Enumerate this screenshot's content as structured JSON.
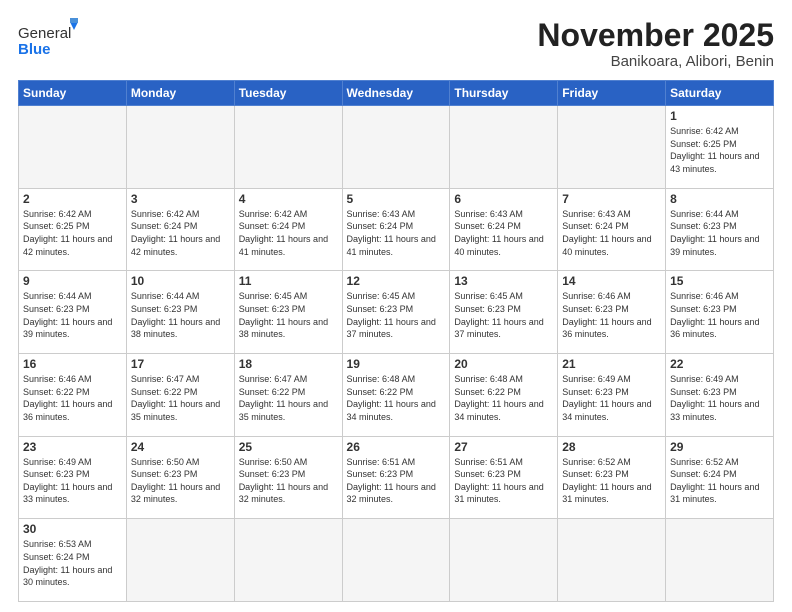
{
  "header": {
    "logo_general": "General",
    "logo_blue": "Blue",
    "month_title": "November 2025",
    "subtitle": "Banikoara, Alibori, Benin"
  },
  "weekdays": [
    "Sunday",
    "Monday",
    "Tuesday",
    "Wednesday",
    "Thursday",
    "Friday",
    "Saturday"
  ],
  "weeks": [
    [
      {
        "day": "",
        "info": ""
      },
      {
        "day": "",
        "info": ""
      },
      {
        "day": "",
        "info": ""
      },
      {
        "day": "",
        "info": ""
      },
      {
        "day": "",
        "info": ""
      },
      {
        "day": "",
        "info": ""
      },
      {
        "day": "1",
        "info": "Sunrise: 6:42 AM\nSunset: 6:25 PM\nDaylight: 11 hours\nand 43 minutes."
      }
    ],
    [
      {
        "day": "2",
        "info": "Sunrise: 6:42 AM\nSunset: 6:25 PM\nDaylight: 11 hours\nand 42 minutes."
      },
      {
        "day": "3",
        "info": "Sunrise: 6:42 AM\nSunset: 6:24 PM\nDaylight: 11 hours\nand 42 minutes."
      },
      {
        "day": "4",
        "info": "Sunrise: 6:42 AM\nSunset: 6:24 PM\nDaylight: 11 hours\nand 41 minutes."
      },
      {
        "day": "5",
        "info": "Sunrise: 6:43 AM\nSunset: 6:24 PM\nDaylight: 11 hours\nand 41 minutes."
      },
      {
        "day": "6",
        "info": "Sunrise: 6:43 AM\nSunset: 6:24 PM\nDaylight: 11 hours\nand 40 minutes."
      },
      {
        "day": "7",
        "info": "Sunrise: 6:43 AM\nSunset: 6:24 PM\nDaylight: 11 hours\nand 40 minutes."
      },
      {
        "day": "8",
        "info": "Sunrise: 6:44 AM\nSunset: 6:23 PM\nDaylight: 11 hours\nand 39 minutes."
      }
    ],
    [
      {
        "day": "9",
        "info": "Sunrise: 6:44 AM\nSunset: 6:23 PM\nDaylight: 11 hours\nand 39 minutes."
      },
      {
        "day": "10",
        "info": "Sunrise: 6:44 AM\nSunset: 6:23 PM\nDaylight: 11 hours\nand 38 minutes."
      },
      {
        "day": "11",
        "info": "Sunrise: 6:45 AM\nSunset: 6:23 PM\nDaylight: 11 hours\nand 38 minutes."
      },
      {
        "day": "12",
        "info": "Sunrise: 6:45 AM\nSunset: 6:23 PM\nDaylight: 11 hours\nand 37 minutes."
      },
      {
        "day": "13",
        "info": "Sunrise: 6:45 AM\nSunset: 6:23 PM\nDaylight: 11 hours\nand 37 minutes."
      },
      {
        "day": "14",
        "info": "Sunrise: 6:46 AM\nSunset: 6:23 PM\nDaylight: 11 hours\nand 36 minutes."
      },
      {
        "day": "15",
        "info": "Sunrise: 6:46 AM\nSunset: 6:23 PM\nDaylight: 11 hours\nand 36 minutes."
      }
    ],
    [
      {
        "day": "16",
        "info": "Sunrise: 6:46 AM\nSunset: 6:22 PM\nDaylight: 11 hours\nand 36 minutes."
      },
      {
        "day": "17",
        "info": "Sunrise: 6:47 AM\nSunset: 6:22 PM\nDaylight: 11 hours\nand 35 minutes."
      },
      {
        "day": "18",
        "info": "Sunrise: 6:47 AM\nSunset: 6:22 PM\nDaylight: 11 hours\nand 35 minutes."
      },
      {
        "day": "19",
        "info": "Sunrise: 6:48 AM\nSunset: 6:22 PM\nDaylight: 11 hours\nand 34 minutes."
      },
      {
        "day": "20",
        "info": "Sunrise: 6:48 AM\nSunset: 6:22 PM\nDaylight: 11 hours\nand 34 minutes."
      },
      {
        "day": "21",
        "info": "Sunrise: 6:49 AM\nSunset: 6:23 PM\nDaylight: 11 hours\nand 34 minutes."
      },
      {
        "day": "22",
        "info": "Sunrise: 6:49 AM\nSunset: 6:23 PM\nDaylight: 11 hours\nand 33 minutes."
      }
    ],
    [
      {
        "day": "23",
        "info": "Sunrise: 6:49 AM\nSunset: 6:23 PM\nDaylight: 11 hours\nand 33 minutes."
      },
      {
        "day": "24",
        "info": "Sunrise: 6:50 AM\nSunset: 6:23 PM\nDaylight: 11 hours\nand 32 minutes."
      },
      {
        "day": "25",
        "info": "Sunrise: 6:50 AM\nSunset: 6:23 PM\nDaylight: 11 hours\nand 32 minutes."
      },
      {
        "day": "26",
        "info": "Sunrise: 6:51 AM\nSunset: 6:23 PM\nDaylight: 11 hours\nand 32 minutes."
      },
      {
        "day": "27",
        "info": "Sunrise: 6:51 AM\nSunset: 6:23 PM\nDaylight: 11 hours\nand 31 minutes."
      },
      {
        "day": "28",
        "info": "Sunrise: 6:52 AM\nSunset: 6:23 PM\nDaylight: 11 hours\nand 31 minutes."
      },
      {
        "day": "29",
        "info": "Sunrise: 6:52 AM\nSunset: 6:24 PM\nDaylight: 11 hours\nand 31 minutes."
      }
    ],
    [
      {
        "day": "30",
        "info": "Sunrise: 6:53 AM\nSunset: 6:24 PM\nDaylight: 11 hours\nand 30 minutes."
      },
      {
        "day": "",
        "info": ""
      },
      {
        "day": "",
        "info": ""
      },
      {
        "day": "",
        "info": ""
      },
      {
        "day": "",
        "info": ""
      },
      {
        "day": "",
        "info": ""
      },
      {
        "day": "",
        "info": ""
      }
    ]
  ]
}
